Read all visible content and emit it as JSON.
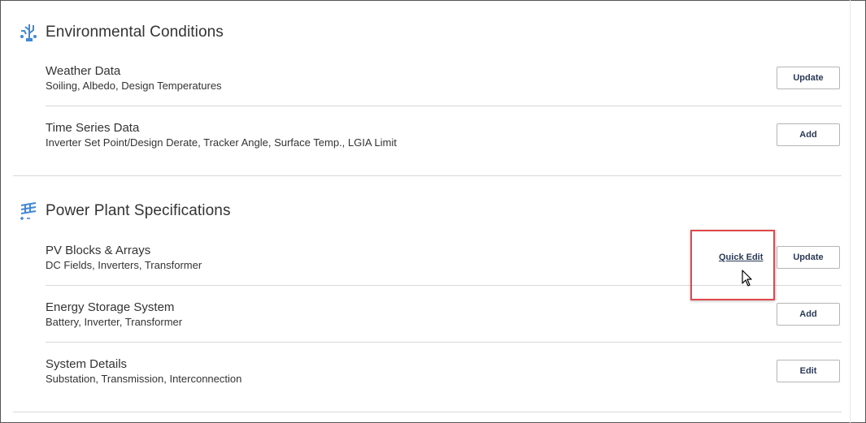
{
  "sections": [
    {
      "title": "Environmental Conditions",
      "icon": "environment-icon",
      "rows": [
        {
          "title": "Weather Data",
          "subtitle": "Soiling, Albedo, Design Temperatures",
          "button": "Update"
        },
        {
          "title": "Time Series Data",
          "subtitle": "Inverter Set Point/Design Derate, Tracker Angle, Surface Temp., LGIA Limit",
          "button": "Add"
        }
      ]
    },
    {
      "title": "Power Plant Specifications",
      "icon": "solar-panel-icon",
      "rows": [
        {
          "title": "PV Blocks & Arrays",
          "subtitle": "DC Fields, Inverters, Transformer",
          "button": "Update",
          "quick_edit": "Quick Edit"
        },
        {
          "title": "Energy Storage System",
          "subtitle": "Battery, Inverter, Transformer",
          "button": "Add"
        },
        {
          "title": "System Details",
          "subtitle": "Substation, Transmission, Interconnection",
          "button": "Edit"
        }
      ]
    }
  ],
  "colors": {
    "accent_icon": "#3f88d6",
    "highlight_box": "#e0474c",
    "button_text": "#2b3a55"
  }
}
